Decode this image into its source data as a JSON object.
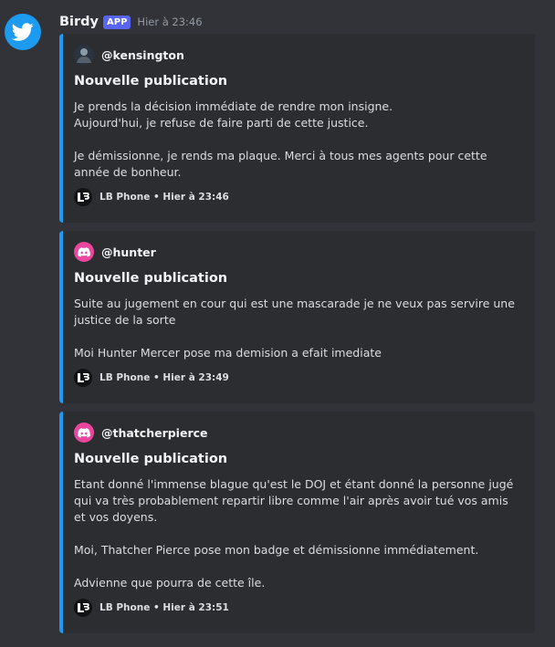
{
  "message": {
    "username": "Birdy",
    "badge": "APP",
    "timestamp": "Hier à 23:46",
    "avatar_icon": "bird-icon"
  },
  "colors": {
    "background": "#313338",
    "embed_background": "#2b2d31",
    "embed_accent": "#1d9bf0",
    "badge": "#5865f2",
    "discord_avatar": "#eb459e"
  },
  "embeds": [
    {
      "author": "@kensington",
      "author_icon": "profile-photo-icon",
      "title": "Nouvelle publication",
      "paragraph1_line1": "Je prends la décision immédiate de rendre mon insigne.",
      "paragraph1_line2": "Aujourd'hui, je refuse de faire parti de cette justice.",
      "paragraph2": "Je démissionne, je rends ma plaque. Merci à tous mes agents pour cette année de bonheur.",
      "footer_icon": "lb-logo-icon",
      "footer": "LB Phone • Hier à 23:46"
    },
    {
      "author": "@hunter",
      "author_icon": "discord-icon",
      "title": "Nouvelle publication",
      "paragraph1": "Suite au jugement en cour qui est une mascarade je ne veux pas servire une justice de la sorte",
      "paragraph2": "Moi Hunter Mercer pose ma demision a efait imediate",
      "footer_icon": "lb-logo-icon",
      "footer": "LB Phone • Hier à 23:49"
    },
    {
      "author": "@thatcherpierce",
      "author_icon": "discord-icon",
      "title": "Nouvelle publication",
      "paragraph1": "Etant donné l'immense blague qu'est le DOJ et étant donné la personne jugé qui va très probablement repartir libre comme l'air après avoir tué vos amis et vos doyens.",
      "paragraph2": "Moi, Thatcher Pierce pose mon badge et démissionne immédiatement.",
      "paragraph3": "Advienne que pourra de cette île.",
      "footer_icon": "lb-logo-icon",
      "footer": "LB Phone • Hier à 23:51"
    }
  ]
}
